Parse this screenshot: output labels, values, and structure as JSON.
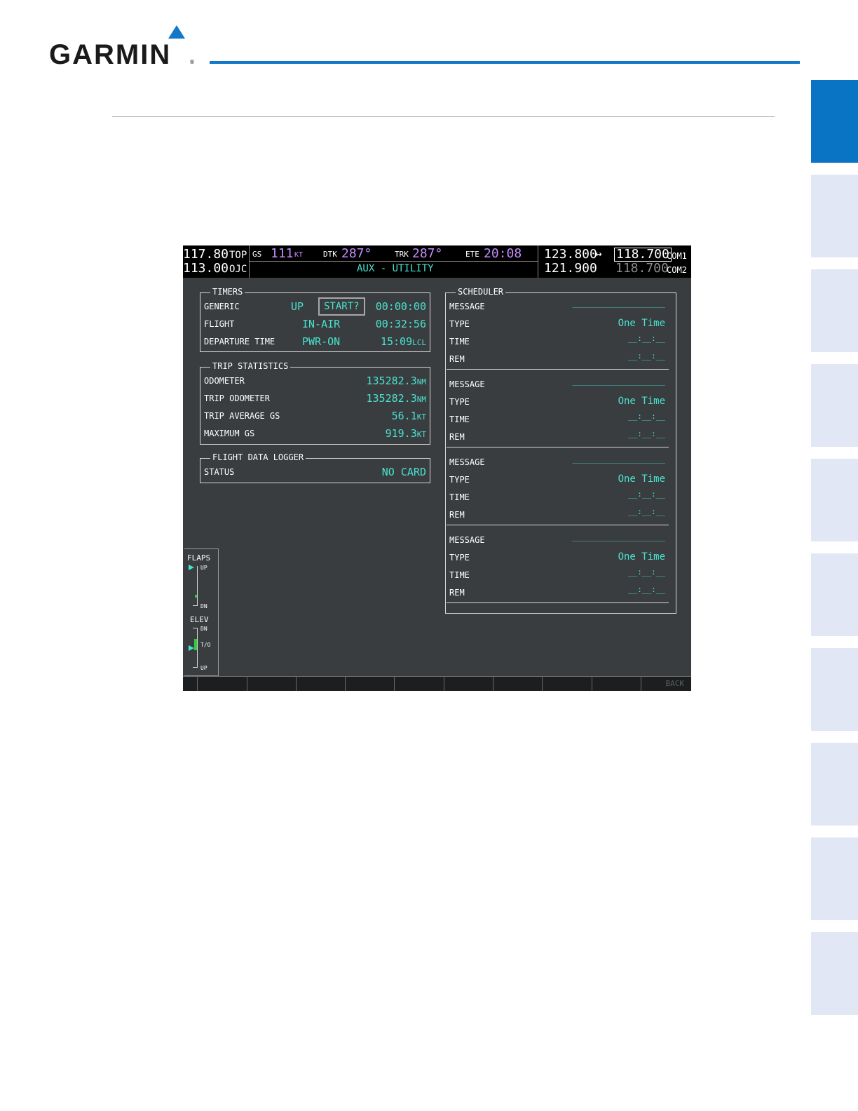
{
  "header": {
    "brand": "GARMIN",
    "brand_mark": "®"
  },
  "colors": {
    "accent": "#1478c8",
    "magenta": "#c68cff",
    "cyan": "#49e2cf"
  },
  "side_tabs_count": 10,
  "screen": {
    "nav": {
      "nav1_freq": "117.80",
      "nav1_id": "TOP",
      "nav2_freq": "113.00",
      "nav2_id": "OJC",
      "gs_label": "GS",
      "gs_value": "111",
      "gs_unit": "KT",
      "dtk_label": "DTK",
      "dtk_value": "287°",
      "trk_label": "TRK",
      "trk_value": "287°",
      "ete_label": "ETE",
      "ete_value": "20:08",
      "page_title": "AUX - UTILITY"
    },
    "com": {
      "com1_standby": "123.800",
      "swap_icon": "↔",
      "com1_active": "118.700",
      "com1_label": "COM1",
      "com2_standby": "121.900",
      "com2_active": "118.700",
      "com2_label": "COM2"
    },
    "timers": {
      "title": "TIMERS",
      "rows": [
        {
          "label": "GENERIC",
          "mode": "UP",
          "button": "START?",
          "value": "00:00:00",
          "unit": ""
        },
        {
          "label": "FLIGHT",
          "mode": "IN-AIR",
          "value": "00:32:56",
          "unit": ""
        },
        {
          "label": "DEPARTURE TIME",
          "mode": "PWR-ON",
          "value": "15:09",
          "unit": "LCL"
        }
      ]
    },
    "trip": {
      "title": "TRIP STATISTICS",
      "rows": [
        {
          "label": "ODOMETER",
          "value": "135282.3",
          "unit": "NM"
        },
        {
          "label": "TRIP ODOMETER",
          "value": "135282.3",
          "unit": "NM"
        },
        {
          "label": "TRIP AVERAGE GS",
          "value": "56.1",
          "unit": "KT"
        },
        {
          "label": "MAXIMUM GS",
          "value": "919.3",
          "unit": "KT"
        }
      ]
    },
    "logger": {
      "title": "FLIGHT DATA LOGGER",
      "status_label": "STATUS",
      "status_value": "NO CARD"
    },
    "scheduler": {
      "title": "SCHEDULER",
      "entries": [
        {
          "message_label": "MESSAGE",
          "message": "____________________",
          "type_label": "TYPE",
          "type": "One Time",
          "time_label": "TIME",
          "time": "__:__:__",
          "rem_label": "REM",
          "rem": "__:__:__"
        },
        {
          "message_label": "MESSAGE",
          "message": "____________________",
          "type_label": "TYPE",
          "type": "One Time",
          "time_label": "TIME",
          "time": "__:__:__",
          "rem_label": "REM",
          "rem": "__:__:__"
        },
        {
          "message_label": "MESSAGE",
          "message": "____________________",
          "type_label": "TYPE",
          "type": "One Time",
          "time_label": "TIME",
          "time": "__:__:__",
          "rem_label": "REM",
          "rem": "__:__:__"
        },
        {
          "message_label": "MESSAGE",
          "message": "____________________",
          "type_label": "TYPE",
          "type": "One Time",
          "time_label": "TIME",
          "time": "__:__:__",
          "rem_label": "REM",
          "rem": "__:__:__"
        }
      ]
    },
    "gauges": {
      "flaps_label": "FLAPS",
      "flaps_up": "UP",
      "flaps_dn": "DN",
      "elev_label": "ELEV",
      "elev_dn": "DN",
      "elev_to": "T/O",
      "elev_up": "UP"
    },
    "softkeys": {
      "last_label": "BACK"
    }
  }
}
